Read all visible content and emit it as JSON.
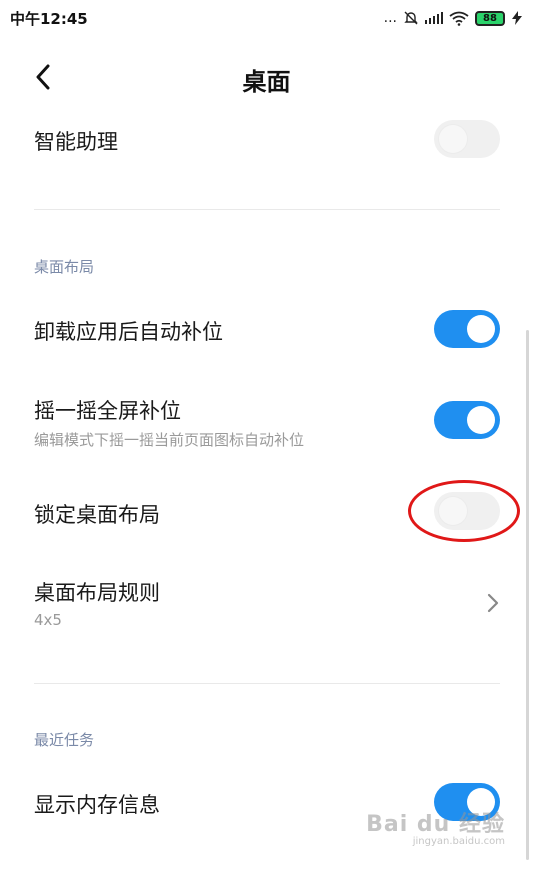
{
  "status_bar": {
    "time": "中午12:45",
    "dots": "...",
    "battery": "88",
    "icons": [
      "mute-bell-icon",
      "signal-icon",
      "wifi-icon",
      "battery-icon",
      "charging-icon"
    ]
  },
  "header": {
    "title": "桌面",
    "back_icon": "chevron-left-icon"
  },
  "rows": {
    "smart_assistant": {
      "title": "智能助理",
      "enabled": false
    },
    "refill_after_uninstall": {
      "title": "卸载应用后自动补位",
      "enabled": true
    },
    "shake_refill": {
      "title": "摇一摇全屏补位",
      "subtitle": "编辑模式下摇一摇当前页面图标自动补位",
      "enabled": true
    },
    "lock_layout": {
      "title": "锁定桌面布局",
      "enabled": false
    },
    "layout_rule": {
      "title": "桌面布局规则",
      "value": "4x5"
    },
    "show_memory": {
      "title": "显示内存信息",
      "enabled": true
    }
  },
  "sections": {
    "desktop_layout": "桌面布局",
    "recent_tasks": "最近任务"
  },
  "watermark": {
    "main": "Bai du 经验",
    "sub": "jingyan.baidu.com"
  },
  "colors": {
    "toggle_on": "#1f8ff0",
    "toggle_off": "#f0f0f0",
    "highlight": "#e01818",
    "section_label": "#7b8aa8"
  }
}
